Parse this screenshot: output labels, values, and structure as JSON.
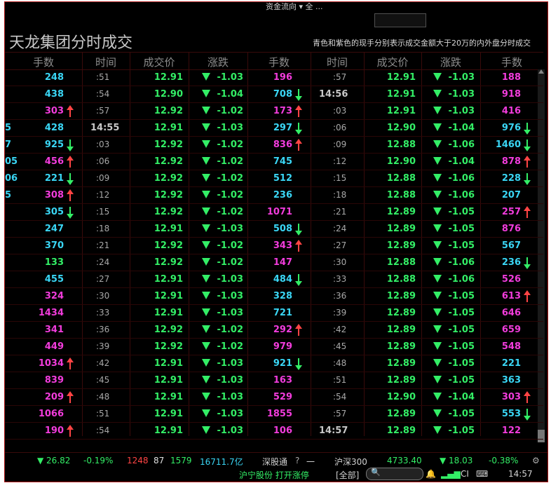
{
  "top": {
    "flow_label": "资金流向 ▾   全 ..."
  },
  "title": "天龙集团分时成交",
  "legend": "青色和紫色的现手分别表示成交金额大于20万的内外盘分时成交",
  "headers": [
    "手数",
    "时间",
    "成交价",
    "涨跌",
    "手数",
    "时间",
    "成交价",
    "涨跌",
    "手数"
  ],
  "colors": {
    "cyan": "#3ad6f5",
    "magenta": "#f23cdc",
    "green": "#33ee66",
    "red": "#ff4444"
  },
  "leftEdge": [
    "",
    "",
    "",
    "5",
    "7",
    "05",
    "06",
    "5",
    "",
    "",
    "",
    "",
    "",
    "",
    "",
    "",
    "",
    "",
    "",
    "",
    "",
    ""
  ],
  "rows": [
    [
      {
        "v": "248",
        "c": "cyan",
        "a": ""
      },
      ":51",
      "12.91",
      "-1.03",
      {
        "v": "196",
        "c": "magenta",
        "a": ""
      },
      ":57",
      "12.91",
      "-1.03",
      {
        "v": "188",
        "c": "magenta",
        "a": ""
      }
    ],
    [
      {
        "v": "438",
        "c": "cyan",
        "a": ""
      },
      ":54",
      "12.90",
      "-1.04",
      {
        "v": "708",
        "c": "cyan",
        "a": "down"
      },
      "14:56",
      "12.91",
      "-1.03",
      {
        "v": "918",
        "c": "magenta",
        "a": ""
      }
    ],
    [
      {
        "v": "303",
        "c": "magenta",
        "a": "up"
      },
      ":57",
      "12.92",
      "-1.02",
      {
        "v": "173",
        "c": "magenta",
        "a": "up"
      },
      ":03",
      "12.91",
      "-1.03",
      {
        "v": "416",
        "c": "magenta",
        "a": ""
      }
    ],
    [
      {
        "v": "428",
        "c": "cyan",
        "a": ""
      },
      "14:55",
      "12.91",
      "-1.03",
      {
        "v": "297",
        "c": "cyan",
        "a": "down"
      },
      ":06",
      "12.90",
      "-1.04",
      {
        "v": "976",
        "c": "cyan",
        "a": "down"
      }
    ],
    [
      {
        "v": "925",
        "c": "cyan",
        "a": "down"
      },
      ":03",
      "12.92",
      "-1.02",
      {
        "v": "836",
        "c": "magenta",
        "a": "up"
      },
      ":09",
      "12.88",
      "-1.06",
      {
        "v": "1460",
        "c": "cyan",
        "a": "down"
      }
    ],
    [
      {
        "v": "456",
        "c": "magenta",
        "a": "up"
      },
      ":06",
      "12.92",
      "-1.02",
      {
        "v": "745",
        "c": "cyan",
        "a": ""
      },
      ":12",
      "12.90",
      "-1.04",
      {
        "v": "878",
        "c": "magenta",
        "a": "up"
      }
    ],
    [
      {
        "v": "221",
        "c": "cyan",
        "a": "down"
      },
      ":09",
      "12.92",
      "-1.02",
      {
        "v": "512",
        "c": "cyan",
        "a": ""
      },
      ":15",
      "12.88",
      "-1.06",
      {
        "v": "228",
        "c": "cyan",
        "a": "down"
      }
    ],
    [
      {
        "v": "308",
        "c": "magenta",
        "a": "up"
      },
      ":12",
      "12.92",
      "-1.02",
      {
        "v": "236",
        "c": "cyan",
        "a": ""
      },
      ":18",
      "12.88",
      "-1.06",
      {
        "v": "207",
        "c": "cyan",
        "a": ""
      }
    ],
    [
      {
        "v": "305",
        "c": "cyan",
        "a": "down"
      },
      ":15",
      "12.92",
      "-1.02",
      {
        "v": "1071",
        "c": "magenta",
        "a": ""
      },
      ":21",
      "12.89",
      "-1.05",
      {
        "v": "257",
        "c": "magenta",
        "a": "up"
      }
    ],
    [
      {
        "v": "247",
        "c": "cyan",
        "a": ""
      },
      ":18",
      "12.91",
      "-1.03",
      {
        "v": "508",
        "c": "cyan",
        "a": "down"
      },
      ":24",
      "12.89",
      "-1.05",
      {
        "v": "876",
        "c": "magenta",
        "a": ""
      }
    ],
    [
      {
        "v": "370",
        "c": "cyan",
        "a": ""
      },
      ":21",
      "12.92",
      "-1.02",
      {
        "v": "343",
        "c": "magenta",
        "a": "up"
      },
      ":27",
      "12.89",
      "-1.05",
      {
        "v": "567",
        "c": "cyan",
        "a": ""
      }
    ],
    [
      {
        "v": "133",
        "c": "green",
        "a": ""
      },
      ":24",
      "12.92",
      "-1.02",
      {
        "v": "147",
        "c": "magenta",
        "a": ""
      },
      ":30",
      "12.88",
      "-1.06",
      {
        "v": "236",
        "c": "cyan",
        "a": "down"
      }
    ],
    [
      {
        "v": "455",
        "c": "cyan",
        "a": ""
      },
      ":27",
      "12.91",
      "-1.03",
      {
        "v": "484",
        "c": "cyan",
        "a": "down"
      },
      ":33",
      "12.88",
      "-1.06",
      {
        "v": "526",
        "c": "magenta",
        "a": ""
      }
    ],
    [
      {
        "v": "324",
        "c": "magenta",
        "a": ""
      },
      ":30",
      "12.91",
      "-1.03",
      {
        "v": "328",
        "c": "cyan",
        "a": ""
      },
      ":36",
      "12.89",
      "-1.05",
      {
        "v": "613",
        "c": "magenta",
        "a": "up"
      }
    ],
    [
      {
        "v": "1434",
        "c": "magenta",
        "a": ""
      },
      ":33",
      "12.91",
      "-1.03",
      {
        "v": "721",
        "c": "cyan",
        "a": ""
      },
      ":39",
      "12.89",
      "-1.05",
      {
        "v": "646",
        "c": "magenta",
        "a": ""
      }
    ],
    [
      {
        "v": "341",
        "c": "magenta",
        "a": ""
      },
      ":36",
      "12.92",
      "-1.02",
      {
        "v": "292",
        "c": "magenta",
        "a": "up"
      },
      ":42",
      "12.89",
      "-1.05",
      {
        "v": "659",
        "c": "magenta",
        "a": ""
      }
    ],
    [
      {
        "v": "449",
        "c": "magenta",
        "a": ""
      },
      ":39",
      "12.92",
      "-1.02",
      {
        "v": "979",
        "c": "magenta",
        "a": ""
      },
      ":45",
      "12.89",
      "-1.05",
      {
        "v": "548",
        "c": "magenta",
        "a": ""
      }
    ],
    [
      {
        "v": "1034",
        "c": "magenta",
        "a": "up"
      },
      ":42",
      "12.91",
      "-1.03",
      {
        "v": "921",
        "c": "cyan",
        "a": "down"
      },
      ":48",
      "12.89",
      "-1.05",
      {
        "v": "221",
        "c": "cyan",
        "a": ""
      }
    ],
    [
      {
        "v": "839",
        "c": "magenta",
        "a": ""
      },
      ":45",
      "12.91",
      "-1.03",
      {
        "v": "163",
        "c": "magenta",
        "a": ""
      },
      ":51",
      "12.89",
      "-1.05",
      {
        "v": "363",
        "c": "cyan",
        "a": ""
      }
    ],
    [
      {
        "v": "209",
        "c": "magenta",
        "a": "up"
      },
      ":48",
      "12.91",
      "-1.03",
      {
        "v": "529",
        "c": "magenta",
        "a": ""
      },
      ":54",
      "12.90",
      "-1.04",
      {
        "v": "303",
        "c": "magenta",
        "a": "up"
      }
    ],
    [
      {
        "v": "1066",
        "c": "magenta",
        "a": ""
      },
      ":51",
      "12.91",
      "-1.03",
      {
        "v": "1855",
        "c": "magenta",
        "a": ""
      },
      ":57",
      "12.89",
      "-1.05",
      {
        "v": "553",
        "c": "cyan",
        "a": "down"
      }
    ],
    [
      {
        "v": "190",
        "c": "magenta",
        "a": "up"
      },
      ":54",
      "12.91",
      "-1.03",
      {
        "v": "106",
        "c": "magenta",
        "a": ""
      },
      "14:57",
      "12.89",
      "-1.05",
      {
        "v": "122",
        "c": "magenta",
        "a": ""
      }
    ]
  ],
  "status": {
    "idx_chg": "▼ 26.82",
    "idx_pct": "-0.19%",
    "up_count": "1248",
    "flat_count": "87",
    "down_count": "1579",
    "amount": "16711.7亿",
    "sgt_label": "深股通",
    "sgt_value": "一",
    "hs300_label": "沪深300",
    "hs300_value": "4733.40",
    "hs300_chg": "▼ 18.03",
    "hs300_pct": "-0.38%"
  },
  "bottom": {
    "ticker": "沪宁股份 打开涨停",
    "filter": "[全部]",
    "clock": "14:57"
  }
}
